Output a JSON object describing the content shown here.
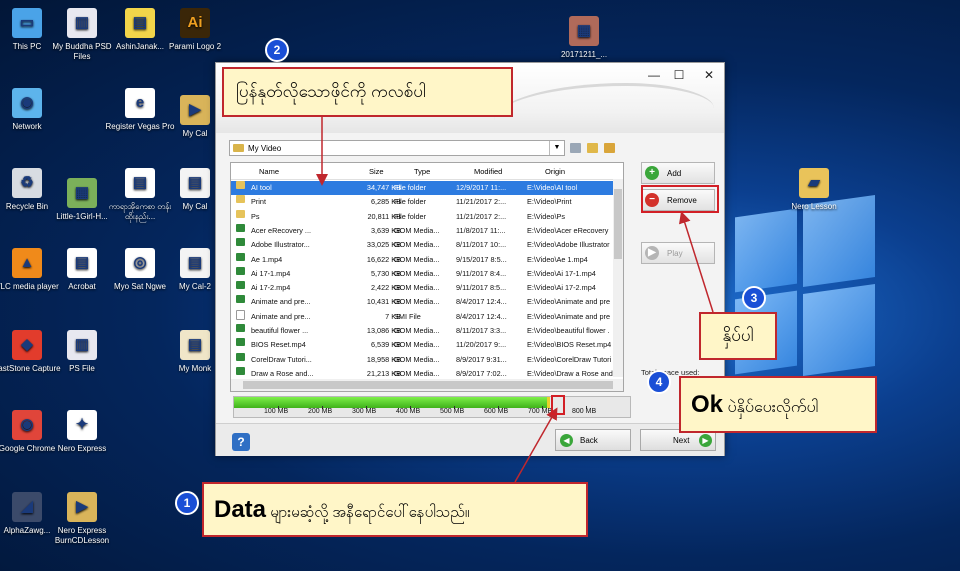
{
  "desktop": {
    "icons": [
      {
        "label": "This PC",
        "icon": "computer-icon",
        "color": "#4aa3e8",
        "glyph": "▭"
      },
      {
        "label": "My Buddha PSD Files",
        "icon": "document-icon",
        "color": "#e8e8f0",
        "glyph": "▥"
      },
      {
        "label": "AshinJanak...",
        "icon": "book-icon",
        "color": "#f2d54a",
        "glyph": "▤"
      },
      {
        "label": "Parami Logo 2",
        "icon": "illustrator-icon",
        "color": "#3a2608",
        "glyph": "Ai"
      },
      {
        "label": "20171211_...",
        "icon": "photo-icon",
        "color": "#b06a5a",
        "glyph": "▦"
      },
      {
        "label": "Network",
        "icon": "network-icon",
        "color": "#5db4ec",
        "glyph": "◉"
      },
      {
        "label": "Register Vegas Pro",
        "icon": "edge-icon",
        "color": "#ffffff",
        "glyph": "e"
      },
      {
        "label": "My Cal",
        "icon": "video-icon",
        "color": "#d9b45a",
        "glyph": "▶"
      },
      {
        "label": "Recycle Bin",
        "icon": "recycle-bin-icon",
        "color": "#d8dce2",
        "glyph": "♻"
      },
      {
        "label": "Little-1Girl-H...",
        "icon": "photo-icon",
        "color": "#7bb05a",
        "glyph": "▦"
      },
      {
        "label": "ကာရာအိုကေစာ တန်းထိုးနည်း...",
        "icon": "pdf-icon",
        "color": "#ffffff",
        "glyph": "▤"
      },
      {
        "label": "My Cal",
        "icon": "document-icon",
        "color": "#f4f4f4",
        "glyph": "▤"
      },
      {
        "label": "VLC media player",
        "icon": "vlc-icon",
        "color": "#f08a1a",
        "glyph": "▲"
      },
      {
        "label": "Acrobat",
        "icon": "pdf-icon",
        "color": "#ffffff",
        "glyph": "▤"
      },
      {
        "label": "Myo Sat Ngwe",
        "icon": "target-icon",
        "color": "#ffffff",
        "glyph": "◎"
      },
      {
        "label": "My Cal-2",
        "icon": "document-icon",
        "color": "#f4f4f4",
        "glyph": "▤"
      },
      {
        "label": "FastStone Capture",
        "icon": "faststone-icon",
        "color": "#e23c2c",
        "glyph": "◆"
      },
      {
        "label": "PS File",
        "icon": "document-icon",
        "color": "#e8e8f0",
        "glyph": "▥"
      },
      {
        "label": "My Monk",
        "icon": "document-icon",
        "color": "#f0e6c8",
        "glyph": "▤"
      },
      {
        "label": "Google Chrome",
        "icon": "chrome-icon",
        "color": "#e0453a",
        "glyph": "◉"
      },
      {
        "label": "Nero Express",
        "icon": "nero-icon",
        "color": "#ffffff",
        "glyph": "✦"
      },
      {
        "label": "AlphaZawg...",
        "icon": "app-icon",
        "color": "#3b4a6a",
        "glyph": "◢"
      },
      {
        "label": "Nero Express BurnCDLesson",
        "icon": "video-icon",
        "color": "#d9b45a",
        "glyph": "▶"
      },
      {
        "label": "Nero Lesson",
        "icon": "folder-icon",
        "color": "#e9c35a",
        "glyph": "▰"
      }
    ]
  },
  "window": {
    "controls": {
      "minimize": "—",
      "maximize": "☐",
      "close": "✕"
    },
    "location": "My Video",
    "columns": [
      "Name",
      "Size",
      "Type",
      "Modified",
      "Origin"
    ],
    "rows": [
      {
        "name": "AI tool",
        "size": "34,747 KB",
        "type": "File folder",
        "modified": "12/9/2017 11:...",
        "origin": "E:\\Video\\AI tool",
        "kind": "folder",
        "selected": true
      },
      {
        "name": "Print",
        "size": "6,285 KB",
        "type": "File folder",
        "modified": "11/21/2017 2:...",
        "origin": "E:\\Video\\Print",
        "kind": "folder"
      },
      {
        "name": "Ps",
        "size": "20,811 KB",
        "type": "File folder",
        "modified": "11/21/2017 2:...",
        "origin": "E:\\Video\\Ps",
        "kind": "folder"
      },
      {
        "name": "Acer eRecovery ...",
        "size": "3,639 KB",
        "type": "GOM Media...",
        "modified": "11/8/2017 11:...",
        "origin": "E:\\Video\\Acer eRecovery",
        "kind": "media"
      },
      {
        "name": "Adobe Illustrator...",
        "size": "33,025 KB",
        "type": "GOM Media...",
        "modified": "8/11/2017 10:...",
        "origin": "E:\\Video\\Adobe Illustrator",
        "kind": "media"
      },
      {
        "name": "Ae 1.mp4",
        "size": "16,622 KB",
        "type": "GOM Media...",
        "modified": "9/15/2017 8:5...",
        "origin": "E:\\Video\\Ae 1.mp4",
        "kind": "media"
      },
      {
        "name": "Ai 17-1.mp4",
        "size": "5,730 KB",
        "type": "GOM Media...",
        "modified": "9/11/2017 8:4...",
        "origin": "E:\\Video\\Ai 17-1.mp4",
        "kind": "media"
      },
      {
        "name": "Ai 17-2.mp4",
        "size": "2,422 KB",
        "type": "GOM Media...",
        "modified": "9/11/2017 8:5...",
        "origin": "E:\\Video\\Ai 17-2.mp4",
        "kind": "media"
      },
      {
        "name": "Animate and pre...",
        "size": "10,431 KB",
        "type": "GOM Media...",
        "modified": "8/4/2017 12:4...",
        "origin": "E:\\Video\\Animate and pre",
        "kind": "media"
      },
      {
        "name": "Animate and pre...",
        "size": "7 KB",
        "type": "SMI File",
        "modified": "8/4/2017 12:4...",
        "origin": "E:\\Video\\Animate and pre",
        "kind": "file"
      },
      {
        "name": "beautiful flower ...",
        "size": "13,086 KB",
        "type": "GOM Media...",
        "modified": "8/11/2017 3:3...",
        "origin": "E:\\Video\\beautiful flower .",
        "kind": "media"
      },
      {
        "name": "BIOS Reset.mp4",
        "size": "6,539 KB",
        "type": "GOM Media...",
        "modified": "11/20/2017 9:...",
        "origin": "E:\\Video\\BIOS Reset.mp4",
        "kind": "media"
      },
      {
        "name": "CorelDraw Tutori...",
        "size": "18,958 KB",
        "type": "GOM Media...",
        "modified": "8/9/2017 9:31...",
        "origin": "E:\\Video\\CorelDraw Tutori",
        "kind": "media"
      },
      {
        "name": "Draw a Rose and...",
        "size": "21,213 KB",
        "type": "GOM Media...",
        "modified": "8/9/2017 7:02...",
        "origin": "E:\\Video\\Draw a Rose and",
        "kind": "media"
      }
    ],
    "side_buttons": {
      "add": "Add",
      "remove": "Remove",
      "play": "Play"
    },
    "total_space_label": "Total space used:",
    "capacity": {
      "used_mb": 712,
      "max_mb": 800,
      "ticks": [
        "100 MB",
        "200 MB",
        "300 MB",
        "400 MB",
        "500 MB",
        "600 MB",
        "700 MB",
        "800 MB"
      ]
    },
    "help": "?",
    "back": "Back",
    "next": "Next"
  },
  "annotations": {
    "step1": {
      "number": "1",
      "bold": "Data",
      "text": " များမဆံ့လို့ အနီရောင်ပေါ်နေပါသည်။"
    },
    "step2": {
      "number": "2",
      "text": "ပြန်နုတ်လိုသောဖိုင်ကို ကလစ်ပါ"
    },
    "step3": {
      "number": "3",
      "text": "နှိပ်ပါ"
    },
    "step4": {
      "number": "4",
      "bold": "Ok",
      "text": " ပဲနှိပ်ပေးလိုက်ပါ"
    }
  },
  "colors": {
    "annotation_border": "#c0272d",
    "annotation_fill": "#fff6c8",
    "badge": "#1a4fd6",
    "selection": "#2d7be0"
  }
}
